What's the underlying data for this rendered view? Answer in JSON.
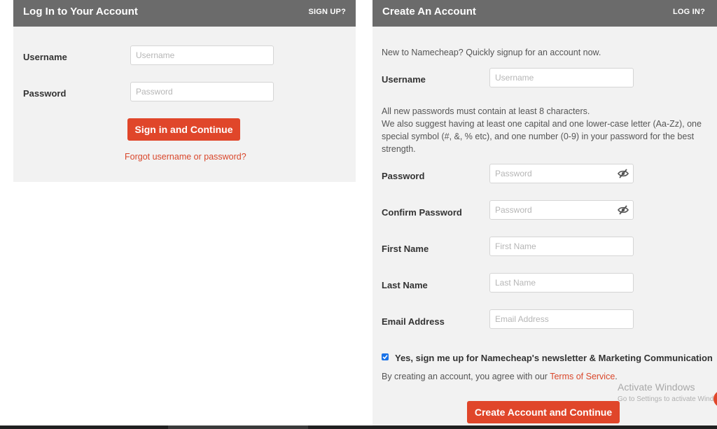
{
  "login": {
    "title": "Log In to Your Account",
    "header_link": "SIGN UP?",
    "username_label": "Username",
    "username_placeholder": "Username",
    "password_label": "Password",
    "password_placeholder": "Password",
    "submit_label": "Sign in and Continue",
    "forgot_link": "Forgot username or password?"
  },
  "signup": {
    "title": "Create An Account",
    "header_link": "LOG IN?",
    "intro": "New to Namecheap? Quickly signup for an account now.",
    "username_label": "Username",
    "username_placeholder": "Username",
    "password_rules_line1": "All new passwords must contain at least 8 characters.",
    "password_rules_line2": "We also suggest having at least one capital and one lower-case letter (Aa-Zz), one",
    "password_rules_line3": "special symbol (#, &, % etc), and one number (0-9) in your password for the best",
    "password_rules_line4": "strength.",
    "password_label": "Password",
    "password_placeholder": "Password",
    "confirm_label": "Confirm Password",
    "confirm_placeholder": "Password",
    "first_name_label": "First Name",
    "first_name_placeholder": "First Name",
    "last_name_label": "Last Name",
    "last_name_placeholder": "Last Name",
    "email_label": "Email Address",
    "email_placeholder": "Email Address",
    "newsletter_checked": true,
    "newsletter_label": "Yes, sign me up for Namecheap's newsletter & Marketing Communication",
    "tos_prefix": "By creating an account, you agree with our ",
    "tos_link": "Terms of Service",
    "tos_suffix": ".",
    "submit_label": "Create Account and Continue"
  },
  "overlay": {
    "activate_title": "Activate Windows",
    "activate_subtitle": "Go to Settings to activate Windows."
  },
  "icons": {
    "password_toggle": "eye-slash-icon",
    "confirm_toggle": "eye-slash-icon",
    "newsletter_check": "checkmark-icon"
  },
  "colors": {
    "accent": "#e0462a",
    "header": "#6b6b6b",
    "panel": "#f2f2f2",
    "checkbox": "#1a73e8"
  }
}
